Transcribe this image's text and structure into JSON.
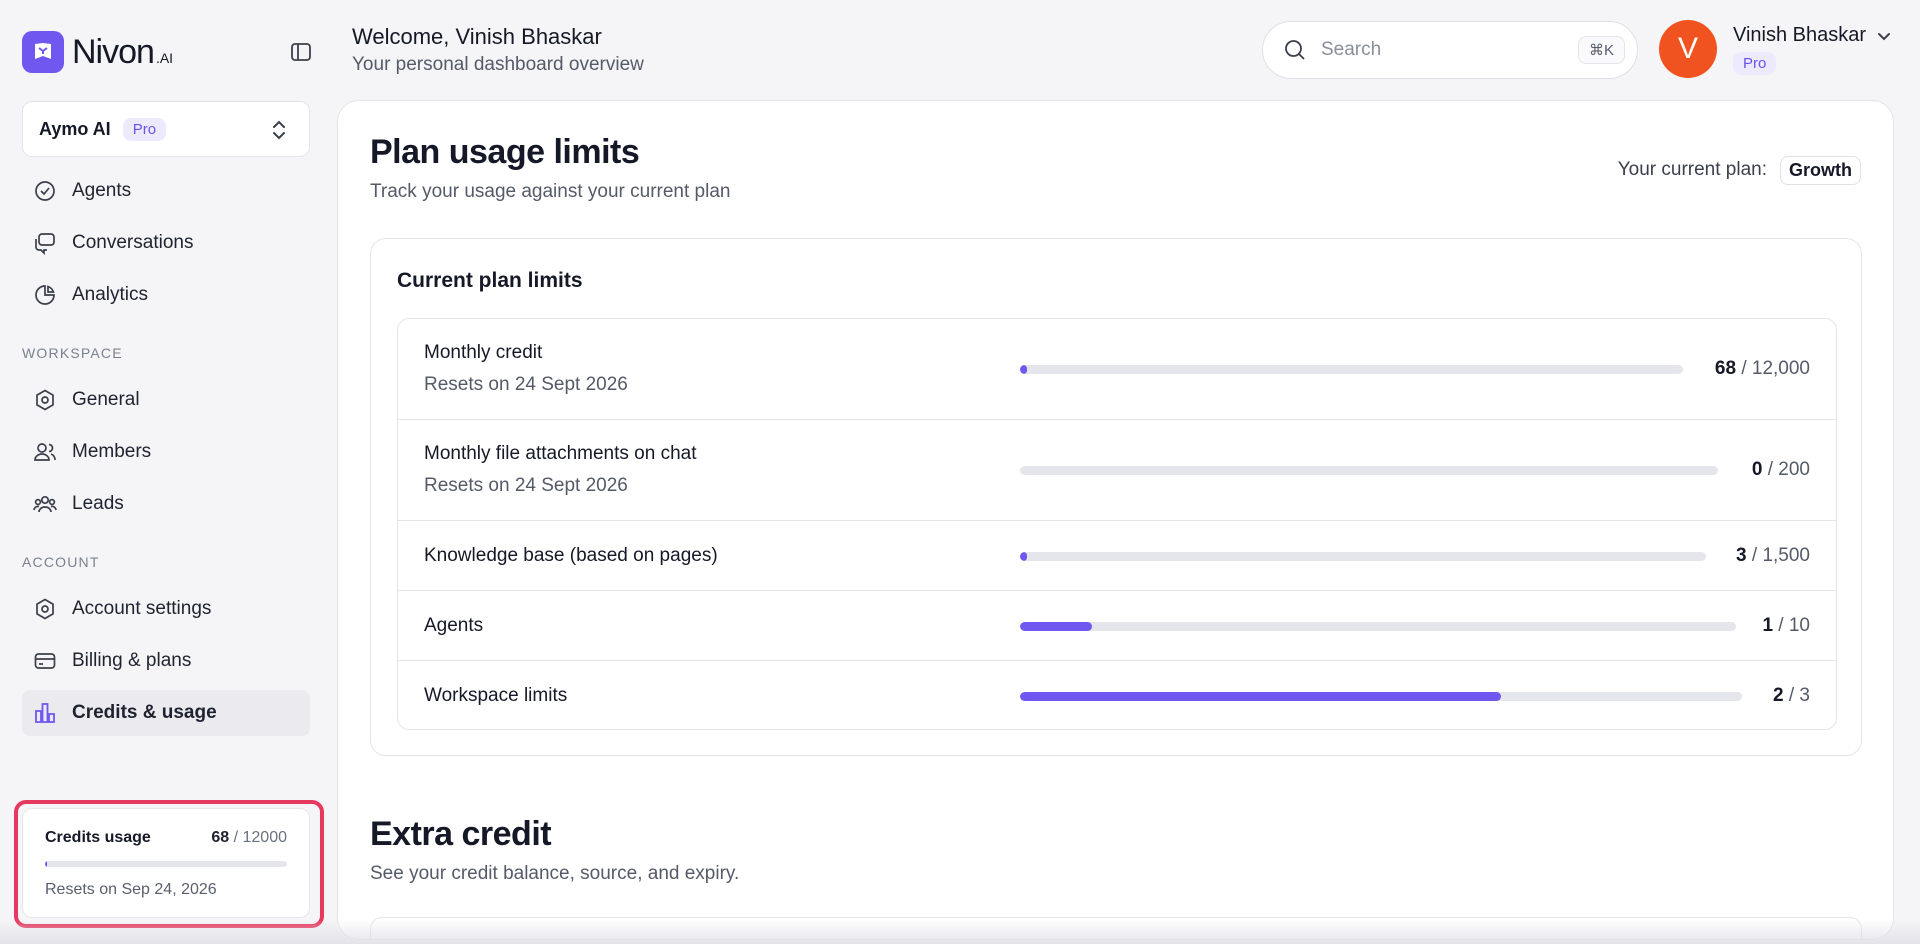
{
  "brand": {
    "name": "Nivon",
    "suffix": ".AI",
    "accent": "#7057f0"
  },
  "workspace": {
    "name": "Aymo AI",
    "badge": "Pro"
  },
  "nav": {
    "main": [
      {
        "label": "Agents",
        "icon": "check-circle-icon"
      },
      {
        "label": "Conversations",
        "icon": "chat-bubbles-icon"
      },
      {
        "label": "Analytics",
        "icon": "pie-chart-icon"
      }
    ],
    "workspace_label": "WORKSPACE",
    "workspace": [
      {
        "label": "General",
        "icon": "settings-icon"
      },
      {
        "label": "Members",
        "icon": "users-icon"
      },
      {
        "label": "Leads",
        "icon": "group-icon"
      }
    ],
    "account_label": "ACCOUNT",
    "account": [
      {
        "label": "Account settings",
        "icon": "settings-icon"
      },
      {
        "label": "Billing & plans",
        "icon": "card-icon"
      },
      {
        "label": "Credits & usage",
        "icon": "bar-chart-icon",
        "active": true
      }
    ]
  },
  "credits_card": {
    "title": "Credits usage",
    "used": "68",
    "sep_total": " / 12000",
    "progress": 0.0057,
    "reset": "Resets on Sep 24, 2026"
  },
  "header": {
    "welcome": "Welcome, Vinish Bhaskar",
    "subtitle": "Your personal dashboard overview",
    "search_placeholder": "Search",
    "search_shortcut": "⌘K",
    "user": {
      "initial": "V",
      "name": "Vinish Bhaskar",
      "badge": "Pro",
      "avatar_color": "#f0531f"
    }
  },
  "main": {
    "title": "Plan usage limits",
    "subtitle": "Track your usage against your current plan",
    "plan_label": "Your current plan:",
    "plan_name": "Growth",
    "limits_title": "Current plan limits",
    "limits": [
      {
        "name": "Monthly credit",
        "reset": "Resets on 24 Sept 2026",
        "used": "68",
        "total": " / 12,000",
        "progress": 0.0057
      },
      {
        "name": "Monthly file attachments on chat",
        "reset": "Resets on 24 Sept 2026",
        "used": "0",
        "total": " / 200",
        "progress": 0
      },
      {
        "name": "Knowledge base (based on pages)",
        "reset": "",
        "used": "3",
        "total": " / 1,500",
        "progress": 0.002
      },
      {
        "name": "Agents",
        "reset": "",
        "used": "1",
        "total": " / 10",
        "progress": 0.1
      },
      {
        "name": "Workspace limits",
        "reset": "",
        "used": "2",
        "total": " / 3",
        "progress": 0.6667
      }
    ],
    "extra_title": "Extra credit",
    "extra_subtitle": "See your credit balance, source, and expiry."
  }
}
